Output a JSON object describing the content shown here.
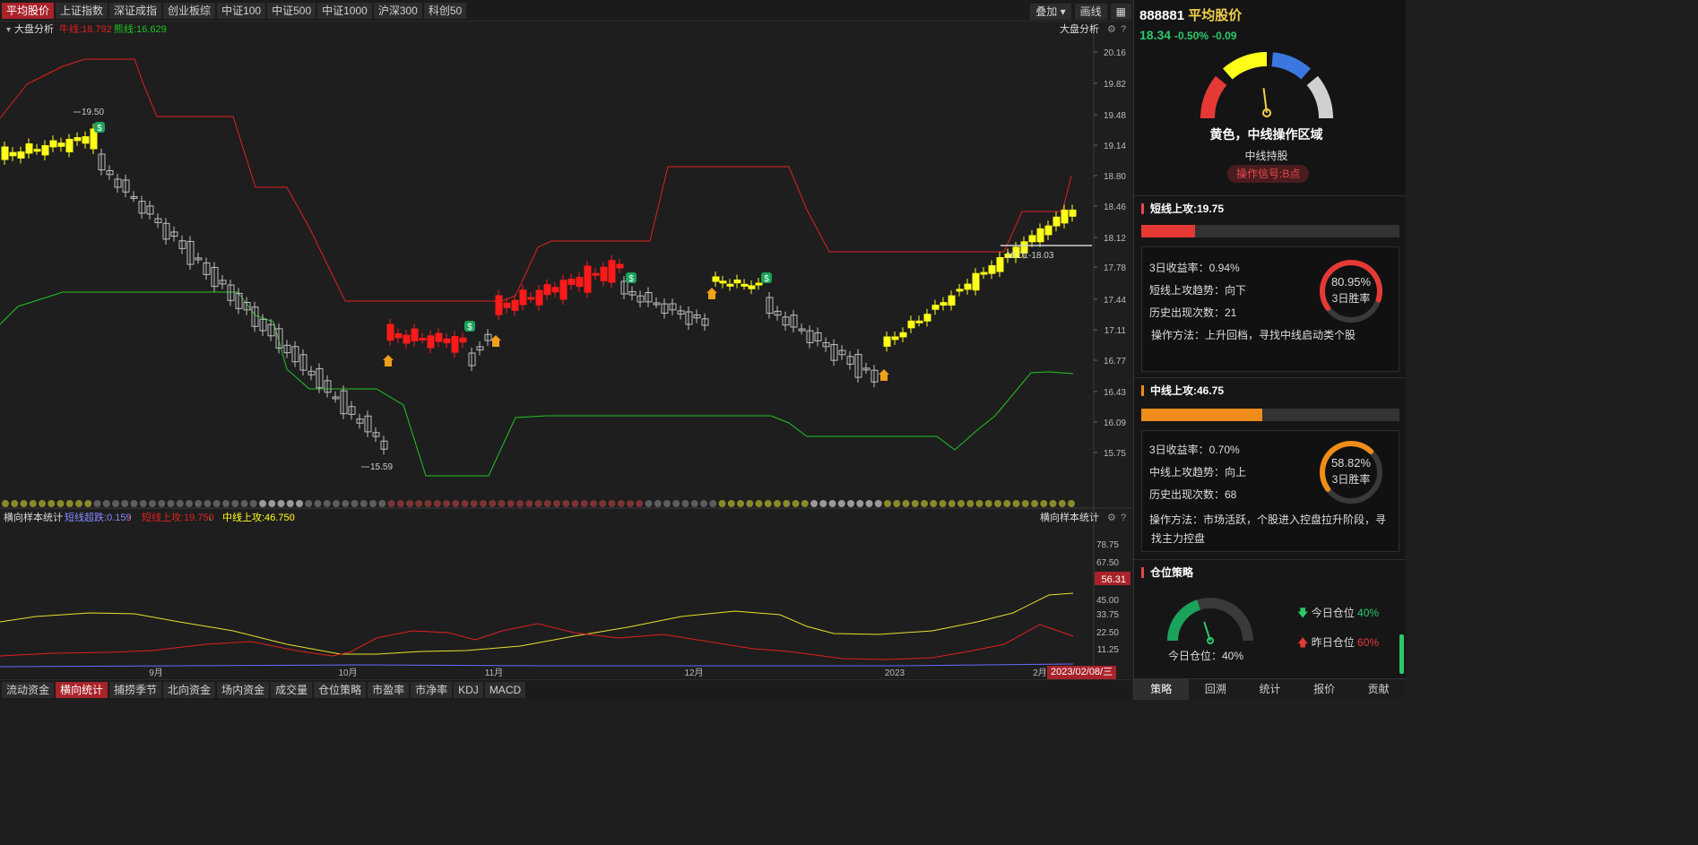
{
  "top_tabs": [
    "平均股价",
    "上证指数",
    "深证成指",
    "创业板综",
    "中证100",
    "中证500",
    "中证1000",
    "沪深300",
    "科创50"
  ],
  "top_right": {
    "overlay": "叠加",
    "draw": "画线"
  },
  "main_chart": {
    "indicator_name": "大盘分析",
    "bull_label": "牛线:18.792",
    "bear_label": "熊线:16.629",
    "right_title": "大盘分析",
    "price_ticks": [
      "20.16",
      "19.82",
      "19.48",
      "19.14",
      "18.80",
      "18.46",
      "18.12",
      "17.78",
      "17.44",
      "17.11",
      "16.77",
      "16.43",
      "16.09",
      "15.75"
    ],
    "high_label": "19.50",
    "low_label": "15.59",
    "range_label": "18.01-18.03"
  },
  "sub_chart": {
    "title": "横向样本统计",
    "right_title": "横向样本统计",
    "short_break": "短线超跌:0.159",
    "short_attack": "短线上攻:19.750",
    "mid_attack": "中线上攻:46.750",
    "ticks": [
      "78.75",
      "67.50",
      "45.00",
      "33.75",
      "22.50",
      "11.25"
    ],
    "current_value": "56.31"
  },
  "x_labels": [
    "9月",
    "10月",
    "11月",
    "12月",
    "2023",
    "2月"
  ],
  "date_badge": "2023/02/08/三",
  "bottom_tabs": [
    "流动资金",
    "横向统计",
    "捕捞季节",
    "北向资金",
    "场内资金",
    "成交量",
    "仓位策略",
    "市盈率",
    "市净率",
    "KDJ",
    "MACD"
  ],
  "stock": {
    "code": "888881",
    "name": "平均股价",
    "price": "18.34",
    "pct": "-0.50%",
    "chg": "-0.09"
  },
  "gauge": {
    "status": "黄色，中线操作区域",
    "hint": "中线持股",
    "signal": "操作信号:B点",
    "level": 0.46
  },
  "short": {
    "title": "短线上攻:19.75",
    "fill": 0.21,
    "lines": [
      "3日收益率：0.94%",
      "短线上攻趋势：向下",
      "历史出现次数：21",
      "操作方法：上升回档，寻找中线启动类个股"
    ],
    "ring_pct": "80.95%",
    "ring_label": "3日胜率",
    "ring_value": 0.8095
  },
  "mid": {
    "title": "中线上攻:46.75",
    "fill": 0.47,
    "lines": [
      "3日收益率：0.70%",
      "中线上攻趋势：向上",
      "历史出现次数：68",
      "操作方法：市场活跃，个股进入控盘拉升阶段，寻",
      "找主力控盘"
    ],
    "ring_pct": "58.82%",
    "ring_label": "3日胜率",
    "ring_value": 0.5882
  },
  "position": {
    "title": "仓位策略",
    "today_label": "今日仓位：40%",
    "today": "今日仓位",
    "today_val": "40%",
    "yest": "昨日仓位",
    "yest_val": "60%",
    "level": 0.4
  },
  "nav": [
    "策略",
    "回溯",
    "统计",
    "报价",
    "贡献"
  ],
  "colors": {
    "up": "#ff1a1a",
    "yellow": "#ffff1a",
    "bull": "#e0201f",
    "bear": "#21c421",
    "accent": "#a8232a"
  }
}
